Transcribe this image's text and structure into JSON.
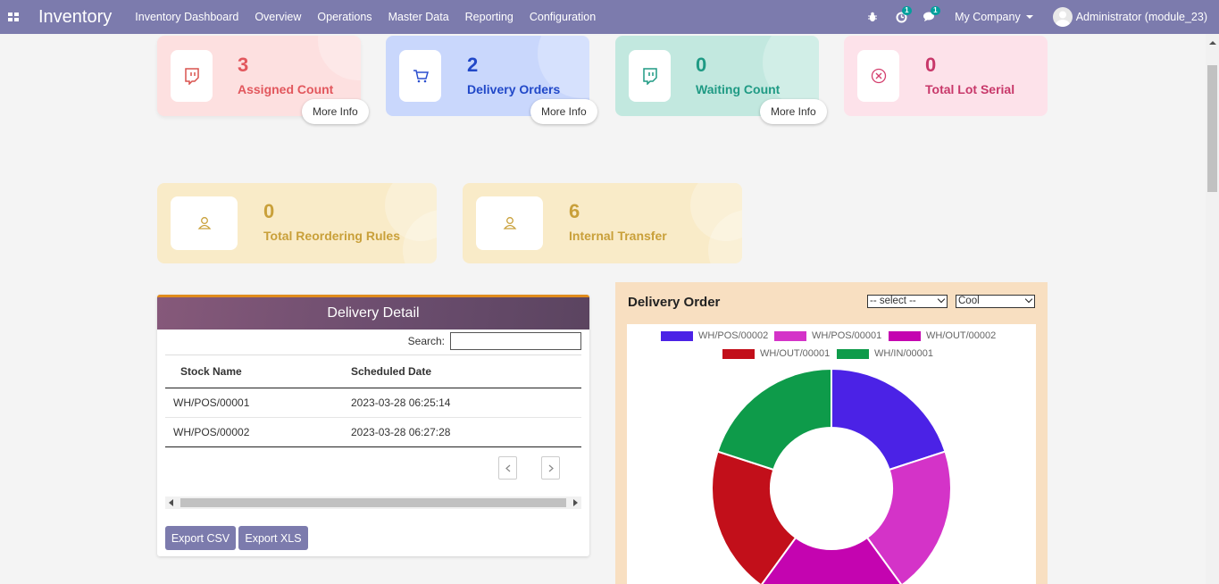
{
  "app": {
    "title": "Inventory"
  },
  "menu": [
    "Inventory Dashboard",
    "Overview",
    "Operations",
    "Master Data",
    "Reporting",
    "Configuration"
  ],
  "topbar": {
    "activity_badge": "1",
    "messages_badge": "1",
    "company": "My Company",
    "user": "Administrator (module_23)"
  },
  "cards": [
    {
      "count": "3",
      "label": "Assigned Count",
      "more": "More Info"
    },
    {
      "count": "2",
      "label": "Delivery Orders",
      "more": "More Info"
    },
    {
      "count": "0",
      "label": "Waiting Count",
      "more": "More Info"
    },
    {
      "count": "0",
      "label": "Total Lot Serial"
    },
    {
      "count": "0",
      "label": "Total Reordering Rules"
    },
    {
      "count": "6",
      "label": "Internal Transfer"
    }
  ],
  "delivery_detail": {
    "title": "Delivery Detail",
    "search_label": "Search:",
    "columns": [
      "Stock Name",
      "Scheduled Date"
    ],
    "rows": [
      [
        "WH/POS/00001",
        "2023-03-28 06:25:14"
      ],
      [
        "WH/POS/00002",
        "2023-03-28 06:27:28"
      ]
    ],
    "export_csv": "Export CSV",
    "export_xls": "Export XLS"
  },
  "delivery_order": {
    "title": "Delivery Order",
    "select1": "-- select --",
    "select2": "Cool"
  },
  "chart_data": {
    "type": "pie",
    "donut": true,
    "categories": [
      "WH/POS/00002",
      "WH/POS/00001",
      "WH/OUT/00002",
      "WH/OUT/00001",
      "WH/IN/00001"
    ],
    "values": [
      1,
      1,
      1,
      1,
      1
    ],
    "colors": [
      "#4b22e6",
      "#d433c8",
      "#c404b0",
      "#c20f1a",
      "#0e9b4a"
    ],
    "legend": "top"
  }
}
